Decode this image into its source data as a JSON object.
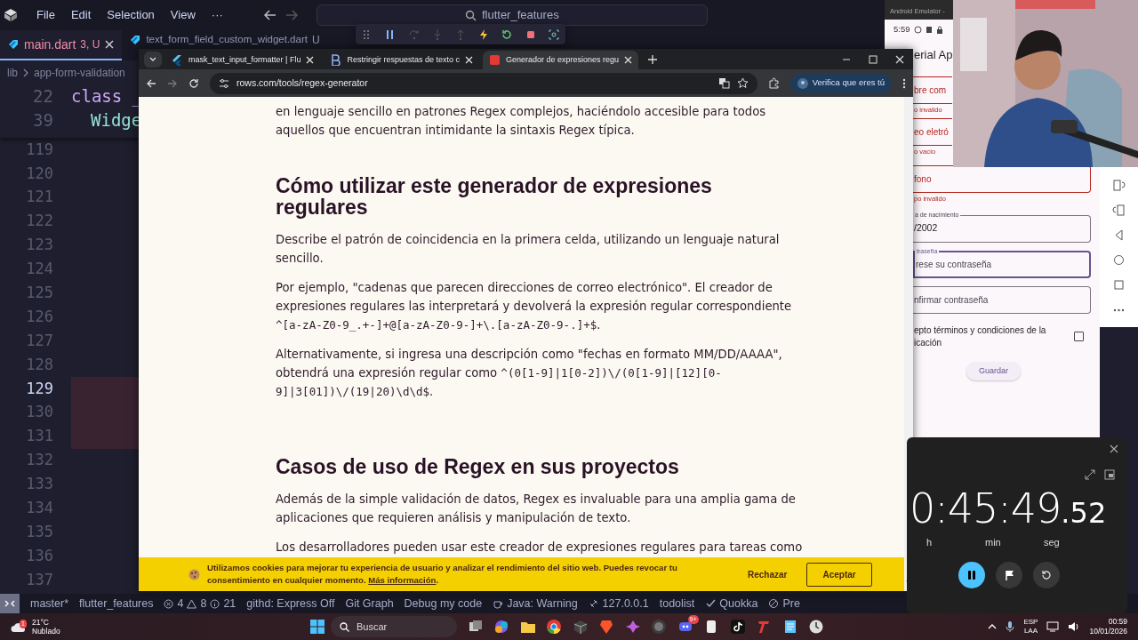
{
  "editor": {
    "menu": [
      "File",
      "Edit",
      "Selection",
      "View",
      "···"
    ],
    "command_center": "flutter_features",
    "tabs": [
      {
        "label": "main.dart",
        "status": "3, U",
        "selected": true
      },
      {
        "label": "text_form_field_custom_widget.dart",
        "status": "U",
        "selected": false
      }
    ],
    "breadcrumb": [
      "lib",
      "app-form-validation"
    ],
    "sticky_lines": [
      {
        "number": "22",
        "code": "class _",
        "kind": "keyword"
      },
      {
        "number": "39",
        "code": "Widge",
        "kind": "type"
      }
    ],
    "lines": [
      {
        "number": "119",
        "current": false,
        "changed": false
      },
      {
        "number": "120",
        "current": false,
        "changed": false
      },
      {
        "number": "121",
        "current": false,
        "changed": false
      },
      {
        "number": "122",
        "current": false,
        "changed": false
      },
      {
        "number": "123",
        "current": false,
        "changed": false
      },
      {
        "number": "124",
        "current": false,
        "changed": false
      },
      {
        "number": "125",
        "current": false,
        "changed": false
      },
      {
        "number": "126",
        "current": false,
        "changed": false
      },
      {
        "number": "127",
        "current": false,
        "changed": false
      },
      {
        "number": "128",
        "current": false,
        "changed": false
      },
      {
        "number": "129",
        "current": true,
        "changed": true
      },
      {
        "number": "130",
        "current": false,
        "changed": true
      },
      {
        "number": "131",
        "current": false,
        "changed": true
      },
      {
        "number": "132",
        "current": false,
        "changed": false
      },
      {
        "number": "133",
        "current": false,
        "changed": false
      },
      {
        "number": "134",
        "current": false,
        "changed": false
      },
      {
        "number": "135",
        "current": false,
        "changed": false
      },
      {
        "number": "136",
        "current": false,
        "changed": false
      },
      {
        "number": "137",
        "current": false,
        "changed": false
      }
    ]
  },
  "status_bar": {
    "branch": "master*",
    "folder": "flutter_features",
    "errors": "4",
    "warnings": "8",
    "infos": "21",
    "items": [
      {
        "kind": "plain",
        "text": "githd: Express Off"
      },
      {
        "kind": "plain",
        "text": "Git Graph"
      },
      {
        "kind": "plain",
        "text": "Debug my code"
      },
      {
        "kind": "java",
        "text": "Java: Warning"
      },
      {
        "kind": "server",
        "text": "127.0.0.1"
      },
      {
        "kind": "plain",
        "text": "todolist"
      },
      {
        "kind": "quokka",
        "text": "Quokka"
      },
      {
        "kind": "prettier",
        "text": "Pre"
      }
    ]
  },
  "browser": {
    "tabs": [
      {
        "title": "mask_text_input_formatter | Flu",
        "selected": false
      },
      {
        "title": "Restringir respuestas de texto c",
        "selected": false
      },
      {
        "title": "Generador de expresiones regu",
        "selected": true
      }
    ],
    "url": "rows.com/tools/regex-generator",
    "profile_button": "Verifica que eres tú",
    "blocks": [
      {
        "kind": "paragraph",
        "parts": [
          {
            "text": "en lenguaje sencillo en patrones Regex complejos, haciéndolo accesible para todos aquellos que encuentran intimidante la sintaxis Regex típica.",
            "code": false
          }
        ]
      },
      {
        "kind": "heading",
        "text": "Cómo utilizar este generador de expresiones regulares"
      },
      {
        "kind": "paragraph",
        "parts": [
          {
            "text": "Describe el patrón de coincidencia en la primera celda, utilizando un lenguaje natural sencillo.",
            "code": false
          }
        ]
      },
      {
        "kind": "paragraph",
        "parts": [
          {
            "text": "Por ejemplo, \"cadenas que parecen direcciones de correo electrónico\". El creador de expresiones regulares las interpretará y devolverá la expresión regular correspondiente ",
            "code": false
          },
          {
            "text": "^[a-zA-Z0-9_.+-]+@[a-zA-Z0-9-]+\\.[a-zA-Z0-9-.]+$",
            "code": true
          },
          {
            "text": ".",
            "code": false
          }
        ]
      },
      {
        "kind": "paragraph",
        "parts": [
          {
            "text": "Alternativamente, si ingresa una descripción como \"fechas en formato MM/DD/AAAA\", obtendrá una expresión regular como ",
            "code": false
          },
          {
            "text": "^(0[1-9]|1[0-2])\\/(0[1-9]|[12][0-9]|3[01])\\/(19|20)\\d\\d$",
            "code": true
          },
          {
            "text": ".",
            "code": false
          }
        ]
      },
      {
        "kind": "heading",
        "text": "Casos de uso de Regex en sus proyectos"
      },
      {
        "kind": "paragraph",
        "parts": [
          {
            "text": "Además de la simple validación de datos, Regex es invaluable para una amplia gama de aplicaciones que requieren análisis y manipulación de texto.",
            "code": false
          }
        ]
      },
      {
        "kind": "paragraph",
        "parts": [
          {
            "text": "Los desarrolladores pueden usar este creador de expresiones regulares para tareas como",
            "code": false
          }
        ]
      }
    ],
    "cookie_banner": {
      "text": "Utilizamos cookies para mejorar tu experiencia de usuario y analizar el rendimiento del sitio web. Puedes revocar tu consentimiento en cualquier momento.",
      "link": "Más información",
      "after_link": ".",
      "reject": "Rechazar",
      "accept": "Aceptar"
    }
  },
  "emulator": {
    "title": "Android Emulator -",
    "time": "5:59",
    "app_title": "erial Ap",
    "fields": [
      {
        "placeholder": "bre com",
        "error": "o invalido",
        "focused": false
      },
      {
        "placeholder": "eo eletró",
        "error": "o vacío",
        "focused": false
      },
      {
        "placeholder": "fono",
        "error": "po invalido",
        "focused": false
      },
      {
        "label": "a de nacimiento",
        "value": "/2002",
        "focused": false
      },
      {
        "label": "traseña",
        "placeholder": "rese su contraseña",
        "focused": true
      },
      {
        "placeholder": "nfirmar contraseña",
        "focused": false
      }
    ],
    "terms": [
      "epto términos y condiciones de la",
      "icación"
    ],
    "accepted": false,
    "button": "Guardar"
  },
  "timer": {
    "display": "0:45:49",
    "fraction": ".52",
    "units": [
      "h",
      "min",
      "seg"
    ],
    "running": true
  },
  "taskbar": {
    "temperature": "21°C",
    "weather": "Nublado",
    "weather_badge": "1",
    "search": "Buscar",
    "apps": [
      {
        "kind": "taskview"
      },
      {
        "kind": "copilot"
      },
      {
        "kind": "folder"
      },
      {
        "kind": "chrome"
      },
      {
        "kind": "terminal"
      },
      {
        "kind": "brave"
      },
      {
        "kind": "colorful"
      },
      {
        "kind": "obs"
      },
      {
        "kind": "discord",
        "badge": "9+"
      },
      {
        "kind": "doc"
      },
      {
        "kind": "tiktok"
      },
      {
        "kind": "tf"
      },
      {
        "kind": "notepad"
      },
      {
        "kind": "clock"
      }
    ],
    "language": "ESP",
    "layout": "LAA",
    "time": "00:59",
    "date": "10/01/2026"
  }
}
